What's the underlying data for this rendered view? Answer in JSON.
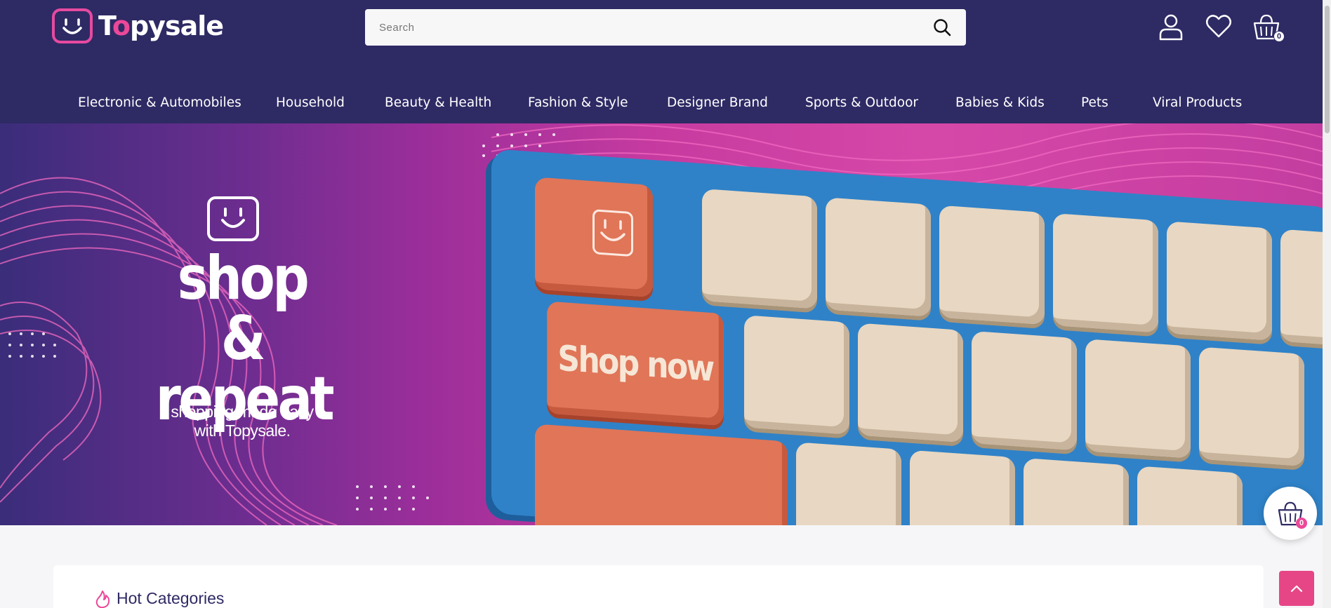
{
  "brand": {
    "name_before": "T",
    "name_o": "o",
    "name_after": "pysale",
    "primary_color": "#2e2a64",
    "accent_color": "#ec4899"
  },
  "search": {
    "placeholder": "Search",
    "icon": "search-icon"
  },
  "header_icons": {
    "account": "user-icon",
    "wishlist": "heart-icon",
    "cart": "basket-icon",
    "cart_count": "0"
  },
  "nav": {
    "items": [
      "Electronic & Automobiles",
      "Household",
      "Beauty & Health",
      "Fashion & Style",
      "Designer Brand",
      "Sports & Outdoor",
      "Babies & Kids",
      "Pets",
      "Viral Products"
    ]
  },
  "hero": {
    "headline_line1": "shop &",
    "headline_line2": "repeat",
    "subtitle_line1": "shopping made easy",
    "subtitle_line2": "with Topysale.",
    "key_label": "Shop now"
  },
  "floating_cart": {
    "count": "0",
    "icon": "basket-icon"
  },
  "sections": {
    "hot_categories_title": "Hot Categories",
    "hot_icon": "fire-icon"
  },
  "back_to_top": {
    "icon": "chevron-up-icon"
  }
}
